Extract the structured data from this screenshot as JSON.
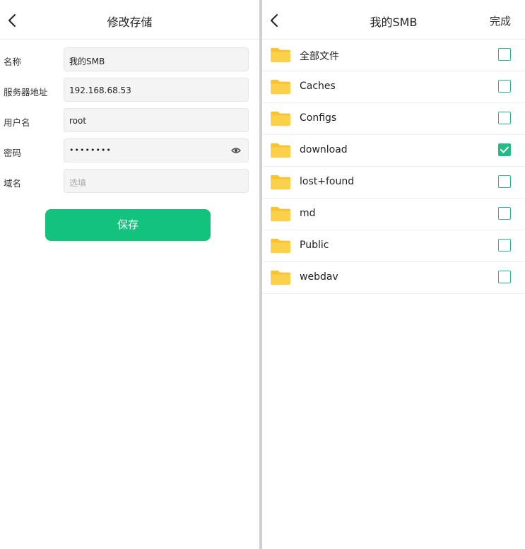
{
  "left": {
    "title": "修改存储",
    "fields": [
      {
        "label": "名称",
        "value": "我的SMB",
        "placeholder": ""
      },
      {
        "label": "服务器地址",
        "value": "192.168.68.53",
        "placeholder": ""
      },
      {
        "label": "用户名",
        "value": "root",
        "placeholder": ""
      },
      {
        "label": "密码",
        "value": "••••••••",
        "placeholder": ""
      },
      {
        "label": "域名",
        "value": "",
        "placeholder": "选填"
      }
    ],
    "save_label": "保存"
  },
  "right": {
    "title": "我的SMB",
    "done_label": "完成",
    "items": [
      {
        "name": "全部文件",
        "checked": false
      },
      {
        "name": "Caches",
        "checked": false
      },
      {
        "name": "Configs",
        "checked": false
      },
      {
        "name": "download",
        "checked": true
      },
      {
        "name": "lost+found",
        "checked": false
      },
      {
        "name": "md",
        "checked": false
      },
      {
        "name": "Public",
        "checked": false
      },
      {
        "name": "webdav",
        "checked": false
      }
    ]
  },
  "colors": {
    "accent": "#12c27d",
    "checkbox": "#22bc86",
    "folder": "#f8c233"
  },
  "icons": [
    "back-arrow-icon",
    "eye-icon",
    "folder-icon",
    "check-icon"
  ]
}
